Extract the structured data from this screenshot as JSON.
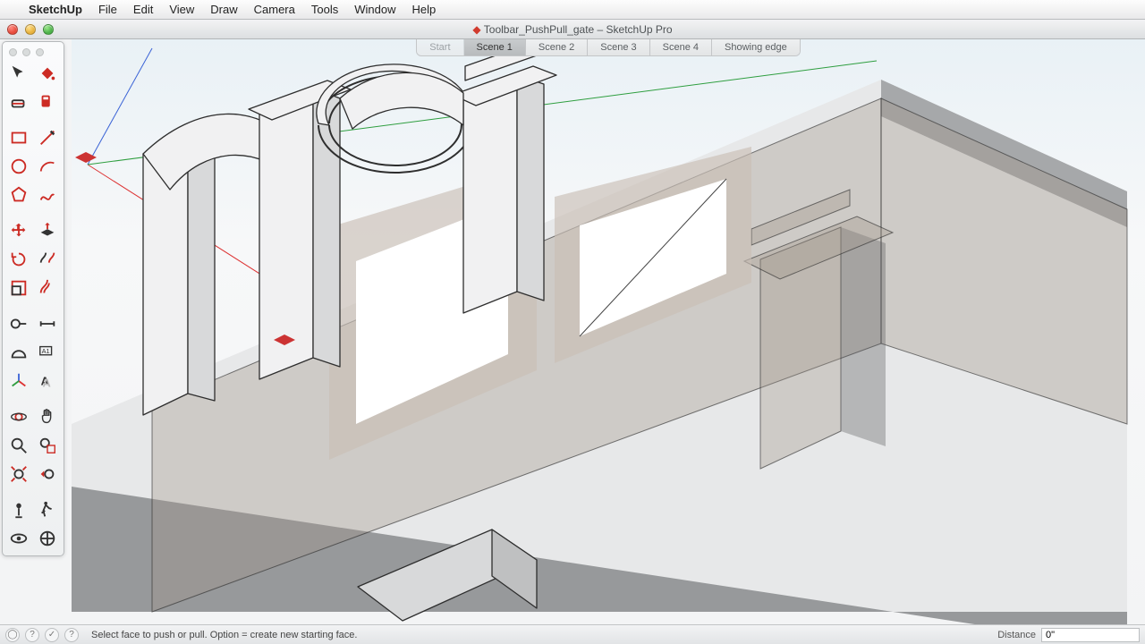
{
  "menubar": {
    "app": "SketchUp",
    "items": [
      "File",
      "Edit",
      "View",
      "Draw",
      "Camera",
      "Tools",
      "Window",
      "Help"
    ]
  },
  "window": {
    "title": "Toolbar_PushPull_gate – SketchUp Pro"
  },
  "scene_tabs": [
    {
      "label": "Start",
      "active": false,
      "ghost": true
    },
    {
      "label": "Scene 1",
      "active": true
    },
    {
      "label": "Scene 2",
      "active": false
    },
    {
      "label": "Scene 3",
      "active": false
    },
    {
      "label": "Scene 4",
      "active": false
    },
    {
      "label": "Showing edge",
      "active": false
    }
  ],
  "tools": {
    "groups": [
      [
        "select",
        "paint-bucket"
      ],
      [
        "eraser",
        "material-sampler"
      ],
      [
        "rectangle",
        "line"
      ],
      [
        "circle",
        "arc"
      ],
      [
        "polygon",
        "freehand"
      ],
      [
        "move",
        "push-pull"
      ],
      [
        "rotate",
        "follow-me"
      ],
      [
        "scale",
        "offset"
      ],
      [
        "tape-measure",
        "dimension"
      ],
      [
        "protractor",
        "text"
      ],
      [
        "axes",
        "3d-text"
      ],
      [
        "orbit",
        "pan"
      ],
      [
        "zoom",
        "zoom-window"
      ],
      [
        "zoom-extents",
        "previous-view"
      ],
      [
        "position-camera",
        "walk"
      ],
      [
        "look-around",
        "section-plane"
      ]
    ]
  },
  "status": {
    "hint": "Select face to push or pull.  Option = create new starting face.",
    "vcb_label": "Distance",
    "vcb_value": "0\""
  },
  "accent_red": "#cc2b24"
}
